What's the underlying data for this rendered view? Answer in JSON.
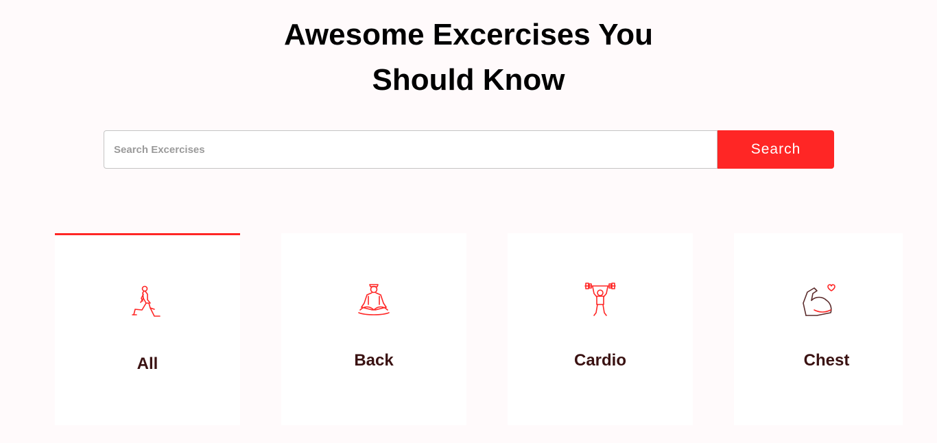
{
  "hero": {
    "title_line1": "Awesome Excercises You",
    "title_line2": "Should Know"
  },
  "search": {
    "placeholder": "Search Excercises",
    "value": "",
    "button_label": "Search"
  },
  "categories": [
    {
      "label": "All",
      "icon": "lunge-icon",
      "active": true
    },
    {
      "label": "Back",
      "icon": "meditation-icon",
      "active": false
    },
    {
      "label": "Cardio",
      "icon": "weightlifter-icon",
      "active": false
    },
    {
      "label": "Chest",
      "icon": "flexed-arm-heart-icon",
      "active": false
    }
  ],
  "colors": {
    "accent": "#ff2625",
    "background": "#fffafb",
    "card": "#ffffff",
    "label": "#3a1212"
  }
}
